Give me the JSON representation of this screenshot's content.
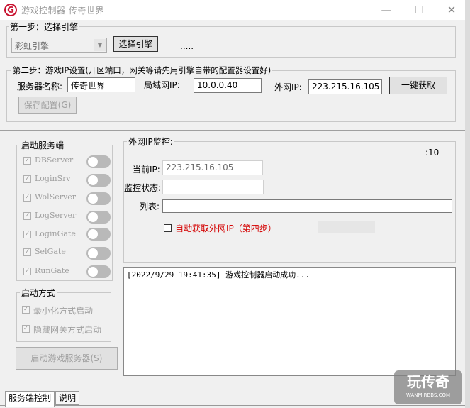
{
  "window": {
    "title": "游戏控制器   传奇世界",
    "minimize": "—",
    "maximize": "☐",
    "close": "✕",
    "app_icon_letter": "G"
  },
  "step1": {
    "legend": "第一步：选择引擎",
    "engine_value": "彩虹引擎",
    "select_button": "选择引擎",
    "dots": "....."
  },
  "step2": {
    "legend": "第二步：游戏IP设置(开区端口，网关等请先用引擎自带的配置器设置好)",
    "server_name_label": "服务器名称:",
    "server_name_value": "传奇世界",
    "lan_ip_label": "局域网IP:",
    "lan_ip_value": "10.0.0.40",
    "wan_ip_label": "外网IP:",
    "wan_ip_value": "223.215.16.105",
    "fetch_button": "一键获取",
    "save_button": "保存配置(G)"
  },
  "services": {
    "legend": "启动服务端",
    "items": [
      {
        "label": "DBServer"
      },
      {
        "label": "LoginSrv"
      },
      {
        "label": "WolServer"
      },
      {
        "label": "LogServer"
      },
      {
        "label": "LoginGate"
      },
      {
        "label": "SelGate"
      },
      {
        "label": "RunGate"
      }
    ]
  },
  "start_mode": {
    "legend": "启动方式",
    "opt1": "最小化方式启动",
    "opt2": "隐藏网关方式启动"
  },
  "start_button": "启动游戏服务器(S)",
  "monitor": {
    "legend": "外网IP监控:",
    "counter": ":10",
    "current_ip_label": "当前IP:",
    "current_ip_value": "223.215.16.105",
    "status_label": "监控状态:",
    "status_value": "",
    "list_label": "列表:",
    "list_value": "",
    "auto_fetch_label": "自动获取外网IP（第四步）"
  },
  "log_text": "[2022/9/29 19:41:35] 游戏控制器启动成功...",
  "tabs": [
    "服务端控制",
    "说明"
  ],
  "watermark": {
    "big": "玩传奇",
    "small": "WANMIRBBS.COM"
  },
  "colors": {
    "accent_red": "#d40000",
    "icon_red": "#c8102e"
  }
}
